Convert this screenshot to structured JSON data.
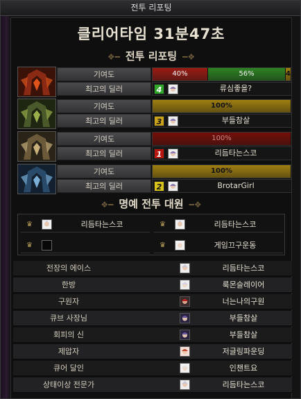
{
  "window": {
    "title": "전투 리포팅"
  },
  "clear_time": {
    "text": "클리어타임 31분47초"
  },
  "report": {
    "title": "전투 리포팅",
    "contribution_label": "기여도",
    "dealer_label": "최고의 딜러",
    "rows": [
      {
        "portrait": "flame-helm-boss-portrait",
        "segments": [
          {
            "label": "40%",
            "percent": 40,
            "color": "#a31c14"
          },
          {
            "label": "56%",
            "percent": 56,
            "color": "#2f8a24"
          },
          {
            "label": "4%",
            "percent": 4,
            "color": "#a8860f"
          }
        ],
        "rank": "4",
        "rank_color": "#2fa52a",
        "dealer": "류심좋을?"
      },
      {
        "portrait": "green-helm-boss-portrait",
        "segments": [
          {
            "label": "100%",
            "percent": 100,
            "color": "#a8860f"
          }
        ],
        "rank": "3",
        "rank_color": "#c9a21a",
        "dealer": "부들참살"
      },
      {
        "portrait": "gold-helm-boss-portrait",
        "segments": [
          {
            "label": "100%",
            "percent": 100,
            "color": "#7a0e08"
          }
        ],
        "rank": "1",
        "rank_color": "#b8170f",
        "dealer": "리듬타는스코"
      },
      {
        "portrait": "blue-helm-boss-portrait",
        "segments": [
          {
            "label": "100%",
            "percent": 100,
            "color": "#a8860f"
          }
        ],
        "rank": "2",
        "rank_color": "#d7c21a",
        "dealer": "BrotarGirl"
      }
    ]
  },
  "honor": {
    "title": "명예 전투 대원",
    "members": [
      {
        "name": "리듬타는스코",
        "avatar": true
      },
      {
        "name": "리듬타는스코",
        "avatar": true
      },
      {
        "name": "",
        "avatar": false
      },
      {
        "name": "게임끄구운동",
        "avatar": true
      }
    ]
  },
  "awards": [
    {
      "title": "전장의 에이스",
      "name": "리듬타는스코"
    },
    {
      "title": "한방",
      "name": "룩몬슬레이어"
    },
    {
      "title": "구원자",
      "name": "너는나의구원"
    },
    {
      "title": "큐브 사장님",
      "name": "부들참살"
    },
    {
      "title": "회피의 신",
      "name": "부들참살"
    },
    {
      "title": "제압자",
      "name": "저글링파운딩"
    },
    {
      "title": "큐어 달인",
      "name": "인챈트요"
    },
    {
      "title": "상태이상 전문가",
      "name": "리듬타는스코"
    }
  ]
}
